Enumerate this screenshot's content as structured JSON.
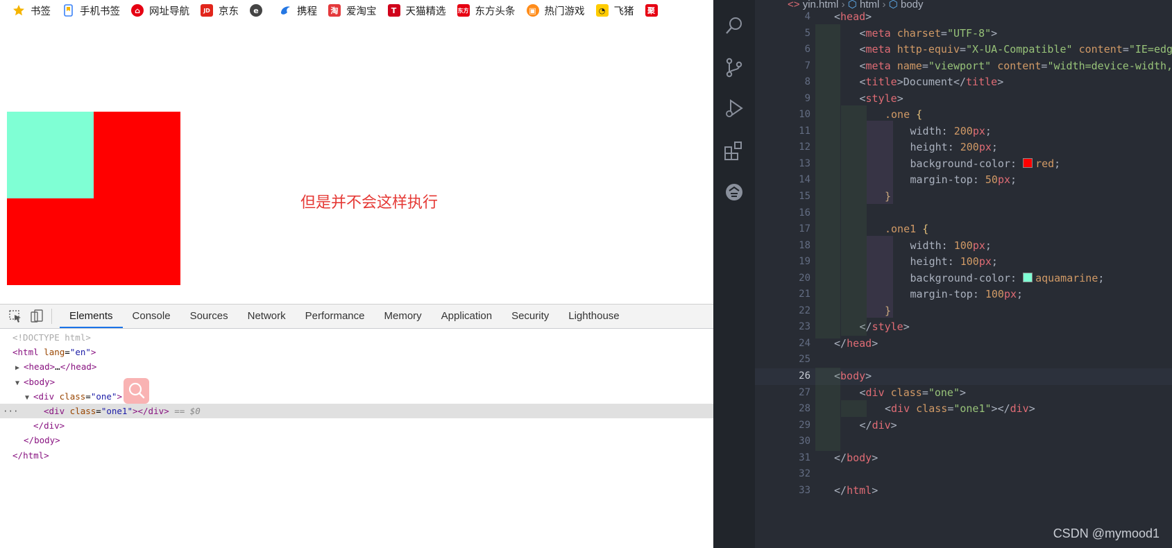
{
  "bookmarks": [
    {
      "label": "书签",
      "icon": "star-icon",
      "color": "#f5b400"
    },
    {
      "label": "手机书签",
      "icon": "phone-bookmark-icon",
      "color": "#3b82f6"
    },
    {
      "label": "网址导航",
      "icon": "navigation-icon",
      "color": "#e60012"
    },
    {
      "label": "京东",
      "icon": "jd-icon",
      "color": "#e1251b",
      "glyph": "JD"
    },
    {
      "label": "",
      "icon": "circle-e-icon",
      "color": "#444444"
    },
    {
      "label": "携程",
      "icon": "ctrip-icon",
      "color": "#2577e3"
    },
    {
      "label": "爱淘宝",
      "icon": "taobao-icon",
      "color": "#e4393c",
      "glyph": "淘"
    },
    {
      "label": "天猫精选",
      "icon": "tmall-icon",
      "color": "#d0021b",
      "glyph": "T"
    },
    {
      "label": "东方头条",
      "icon": "dongfang-icon",
      "color": "#e60012",
      "glyph": "东方"
    },
    {
      "label": "热门游戏",
      "icon": "game-icon",
      "color": "#ff8c1a"
    },
    {
      "label": "飞猪",
      "icon": "fliggy-icon",
      "color": "#ffcc00"
    },
    {
      "label": "",
      "icon": "ju-icon",
      "color": "#e60012",
      "glyph": "聚"
    }
  ],
  "page": {
    "annotation": "但是并不会这样执行"
  },
  "devtools": {
    "tabs": [
      "Elements",
      "Console",
      "Sources",
      "Network",
      "Performance",
      "Memory",
      "Application",
      "Security",
      "Lighthouse"
    ],
    "active_tab": "Elements",
    "dom": {
      "doctype": "<!DOCTYPE html>",
      "html_open": "html",
      "html_lang_attr": "lang",
      "html_lang_val": "\"en\"",
      "head_collapsed": "head",
      "head_ellipsis": "…",
      "body": "body",
      "div": "div",
      "class_attr": "class",
      "one_val": "\"one\"",
      "one1_val": "\"one1\"",
      "selected_marker": "== $0",
      "ellipsis": "···"
    }
  },
  "editor": {
    "breadcrumb": {
      "file": "yin.html",
      "node1": "html",
      "node2": "body"
    },
    "lines": [
      {
        "n": "4",
        "text": "<head>"
      },
      {
        "n": "5",
        "text": "<meta charset=\"UTF-8\">"
      },
      {
        "n": "6",
        "text": "<meta http-equiv=\"X-UA-Compatible\" content=\"IE=edg"
      },
      {
        "n": "7",
        "text": "<meta name=\"viewport\" content=\"width=device-width,"
      },
      {
        "n": "8",
        "text": "<title>Document</title>"
      },
      {
        "n": "9",
        "text": "<style>"
      },
      {
        "n": "10",
        "text": ".one {"
      },
      {
        "n": "11",
        "text": "width: 200px;"
      },
      {
        "n": "12",
        "text": "height: 200px;"
      },
      {
        "n": "13",
        "text": "background-color: red;"
      },
      {
        "n": "14",
        "text": "margin-top: 50px;"
      },
      {
        "n": "15",
        "text": "}"
      },
      {
        "n": "16",
        "text": ""
      },
      {
        "n": "17",
        "text": ".one1 {"
      },
      {
        "n": "18",
        "text": "width: 100px;"
      },
      {
        "n": "19",
        "text": "height: 100px;"
      },
      {
        "n": "20",
        "text": "background-color: aquamarine;"
      },
      {
        "n": "21",
        "text": "margin-top: 100px;"
      },
      {
        "n": "22",
        "text": "}"
      },
      {
        "n": "23",
        "text": "</style>"
      },
      {
        "n": "24",
        "text": "</head>"
      },
      {
        "n": "25",
        "text": ""
      },
      {
        "n": "26",
        "text": "<body>"
      },
      {
        "n": "27",
        "text": "<div class=\"one\">"
      },
      {
        "n": "28",
        "text": "<div class=\"one1\"></div>"
      },
      {
        "n": "29",
        "text": "</div>"
      },
      {
        "n": "30",
        "text": ""
      },
      {
        "n": "31",
        "text": "</body>"
      },
      {
        "n": "32",
        "text": ""
      },
      {
        "n": "33",
        "text": "</html>"
      }
    ],
    "current_line": "26",
    "watermark": "CSDN @mymood1"
  },
  "colors": {
    "red_box": "#ff0000",
    "aqua_box": "#7fffd4",
    "annotation": "#e53935",
    "editor_bg": "#282c34"
  }
}
